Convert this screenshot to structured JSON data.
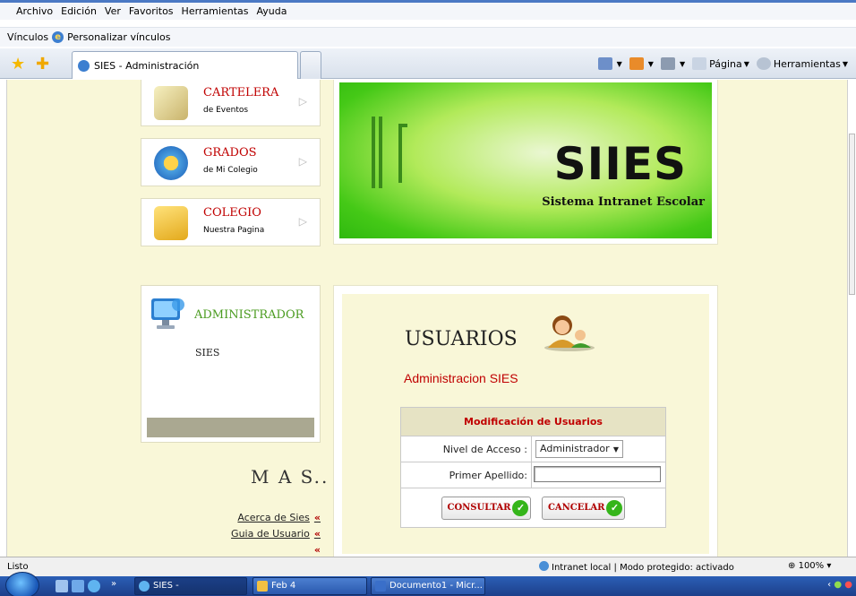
{
  "menubar": {
    "items": [
      "Archivo",
      "Edición",
      "Ver",
      "Favoritos",
      "Herramientas",
      "Ayuda"
    ]
  },
  "linksbar": {
    "label": "Vínculos",
    "link": "Personalizar vínculos"
  },
  "tabs": {
    "active_title": "SIES - Administración"
  },
  "commandbar": {
    "page_label": "Página",
    "tools_label": "Herramientas"
  },
  "sidebar": {
    "nav": [
      {
        "title": "CARTELERA",
        "subtitle": "de Eventos",
        "icon": "notepad-icon"
      },
      {
        "title": "GRADOS",
        "subtitle": "de Mi Colegio",
        "icon": "gear-icon"
      },
      {
        "title": "COLEGIO",
        "subtitle": "Nuestra Pagina",
        "icon": "folder-icon"
      }
    ],
    "admin": {
      "title": "ADMINISTRADOR",
      "subtitle": "SIES"
    },
    "mas_title": "M A S..",
    "links": [
      "Acerca de Sies",
      "Guia de Usuario"
    ],
    "link_marker": "«"
  },
  "banner": {
    "logo_text": "SIIES",
    "subtitle": "Sistema Intranet Escolar"
  },
  "main": {
    "heading": "USUARIOS",
    "subheading": "Administracion SIES",
    "form": {
      "title": "Modificación de Usuarios",
      "nivel_label": "Nivel de Acceso :",
      "nivel_value": "Administrador",
      "apellido_label": "Primer Apellido:",
      "apellido_value": "",
      "consultar_label": "CONSULTAR",
      "cancelar_label": "CANCELAR"
    }
  },
  "statusbar": {
    "status": "Listo",
    "zone": "Intranet local | Modo protegido: activado",
    "zoom": "100%"
  },
  "taskbar": {
    "tasks": [
      "SIES - Administració...",
      "Feb 4",
      "Documento1 - Micr..."
    ]
  },
  "colors": {
    "page_bg": "#f9f7d8",
    "accent_red": "#c00000",
    "accent_green": "#4a9b1f"
  }
}
